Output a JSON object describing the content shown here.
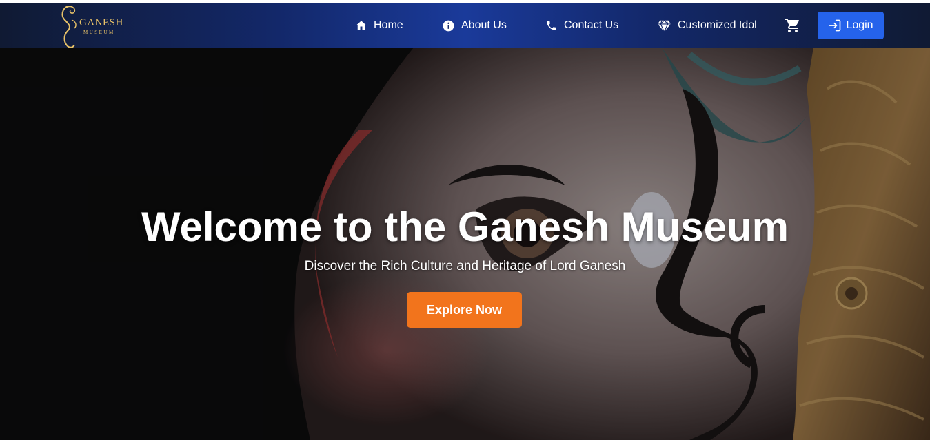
{
  "brand": {
    "name": "GANESH",
    "subtitle": "MUSEUM",
    "gold": "#e8c268"
  },
  "nav": {
    "items": [
      {
        "label": "Home",
        "icon": "home-icon"
      },
      {
        "label": "About Us",
        "icon": "info-icon"
      },
      {
        "label": "Contact Us",
        "icon": "phone-icon"
      },
      {
        "label": "Customized Idol",
        "icon": "diamond-icon"
      }
    ],
    "cart_icon": "cart-icon",
    "login_label": "Login",
    "login_icon": "login-icon"
  },
  "hero": {
    "title": "Welcome to the Ganesh Museum",
    "subtitle": "Discover the Rich Culture and Heritage of Lord Ganesh",
    "cta_label": "Explore Now"
  },
  "colors": {
    "navbar_center": "#1a3a9a",
    "navbar_edge": "#101a33",
    "login_button": "#2563eb",
    "cta_button": "#f2741c"
  }
}
